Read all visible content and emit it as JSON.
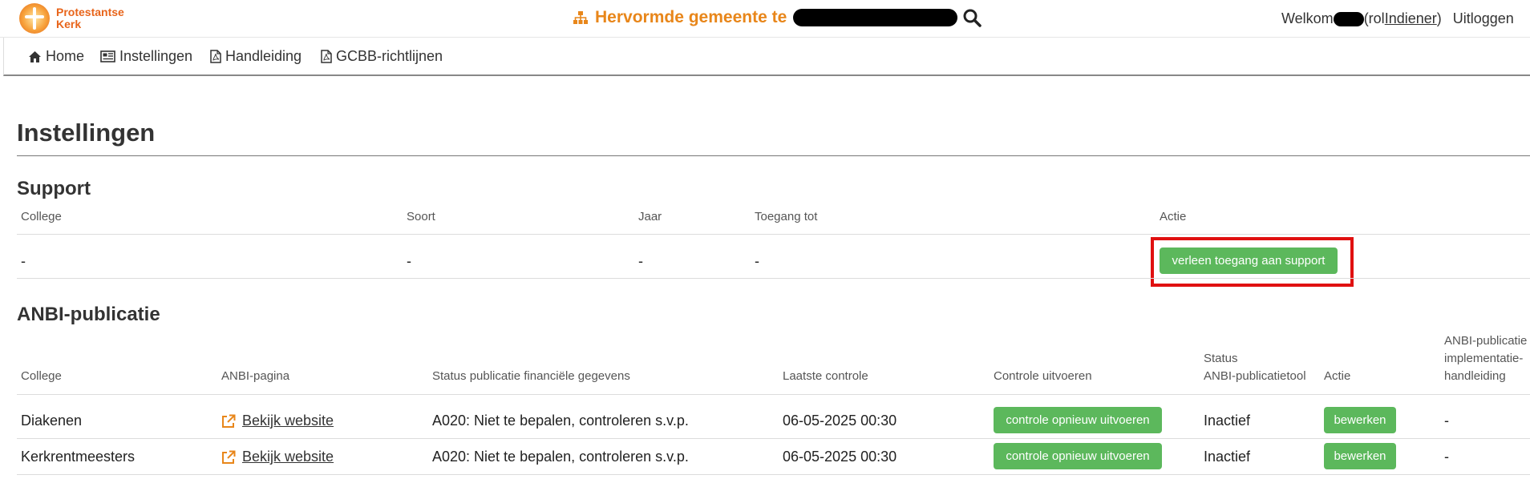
{
  "header": {
    "logo_line1": "Protestantse",
    "logo_line2": "Kerk",
    "congregation_prefix": "Hervormde gemeente te",
    "welcome": "Welkom",
    "role_prefix": "(rol ",
    "role": "Indiener",
    "role_suffix": ")",
    "logout": "Uitloggen"
  },
  "nav": {
    "home": "Home",
    "settings": "Instellingen",
    "manual": "Handleiding",
    "gcbb": "GCBB-richtlijnen"
  },
  "page_title": "Instellingen",
  "support": {
    "title": "Support",
    "headers": [
      "College",
      "Soort",
      "Jaar",
      "Toegang tot",
      "Actie"
    ],
    "row": [
      "-",
      "-",
      "-",
      "-"
    ],
    "button": "verleen toegang aan support"
  },
  "anbi": {
    "title": "ANBI-publicatie",
    "headers": {
      "college": "College",
      "page": "ANBI-pagina",
      "status_fin": "Status publicatie financiële gegevens",
      "last_check": "Laatste controle",
      "run_check": "Controle uitvoeren",
      "status_tool_1": "Status",
      "status_tool_2": "ANBI-publicatietool",
      "action": "Actie",
      "guide_1": "ANBI-publicatie",
      "guide_2": "implementatie-",
      "guide_3": "handleiding"
    },
    "rows": [
      {
        "college": "Diakenen",
        "link": "Bekijk website",
        "status": "A020: Niet te bepalen, controleren s.v.p.",
        "date": "06-05-2025 00:30",
        "check_button": "controle opnieuw uitvoeren",
        "tool_status": "Inactief",
        "edit_button": "bewerken",
        "guide": "-"
      },
      {
        "college": "Kerkrentmeesters",
        "link": "Bekijk website",
        "status": "A020: Niet te bepalen, controleren s.v.p.",
        "date": "06-05-2025 00:30",
        "check_button": "controle opnieuw uitvoeren",
        "tool_status": "Inactief",
        "edit_button": "bewerken",
        "guide": "-"
      }
    ]
  },
  "colors": {
    "brand_orange": "#e8861a",
    "button_green": "#5cb85c",
    "highlight_red": "#e01010"
  }
}
